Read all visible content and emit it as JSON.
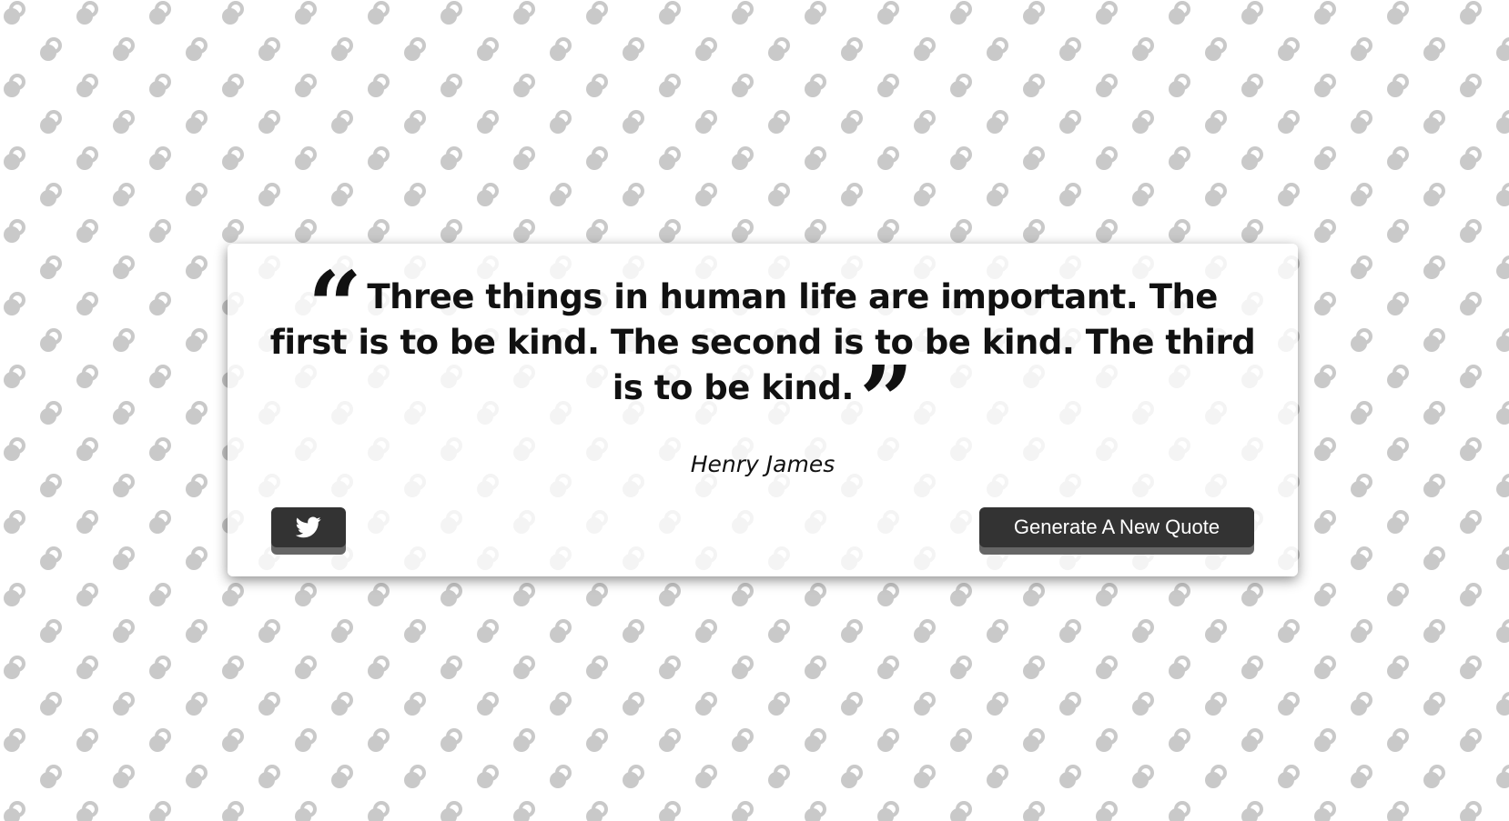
{
  "quote": {
    "open_mark": "“",
    "text": "Three things in human life are important. The first is to be kind. The second is to be kind. The third is to be kind.",
    "close_mark": "”",
    "author": "Henry James"
  },
  "actions": {
    "tweet_icon": "twitter-icon",
    "new_quote_label": "Generate A New Quote"
  },
  "colors": {
    "background": "#ffffff",
    "pattern": "#c9c9c9",
    "card": "#ffffff",
    "text": "#111111",
    "button": "#333333",
    "button_shadow": "#666666",
    "button_text": "#ffffff"
  }
}
